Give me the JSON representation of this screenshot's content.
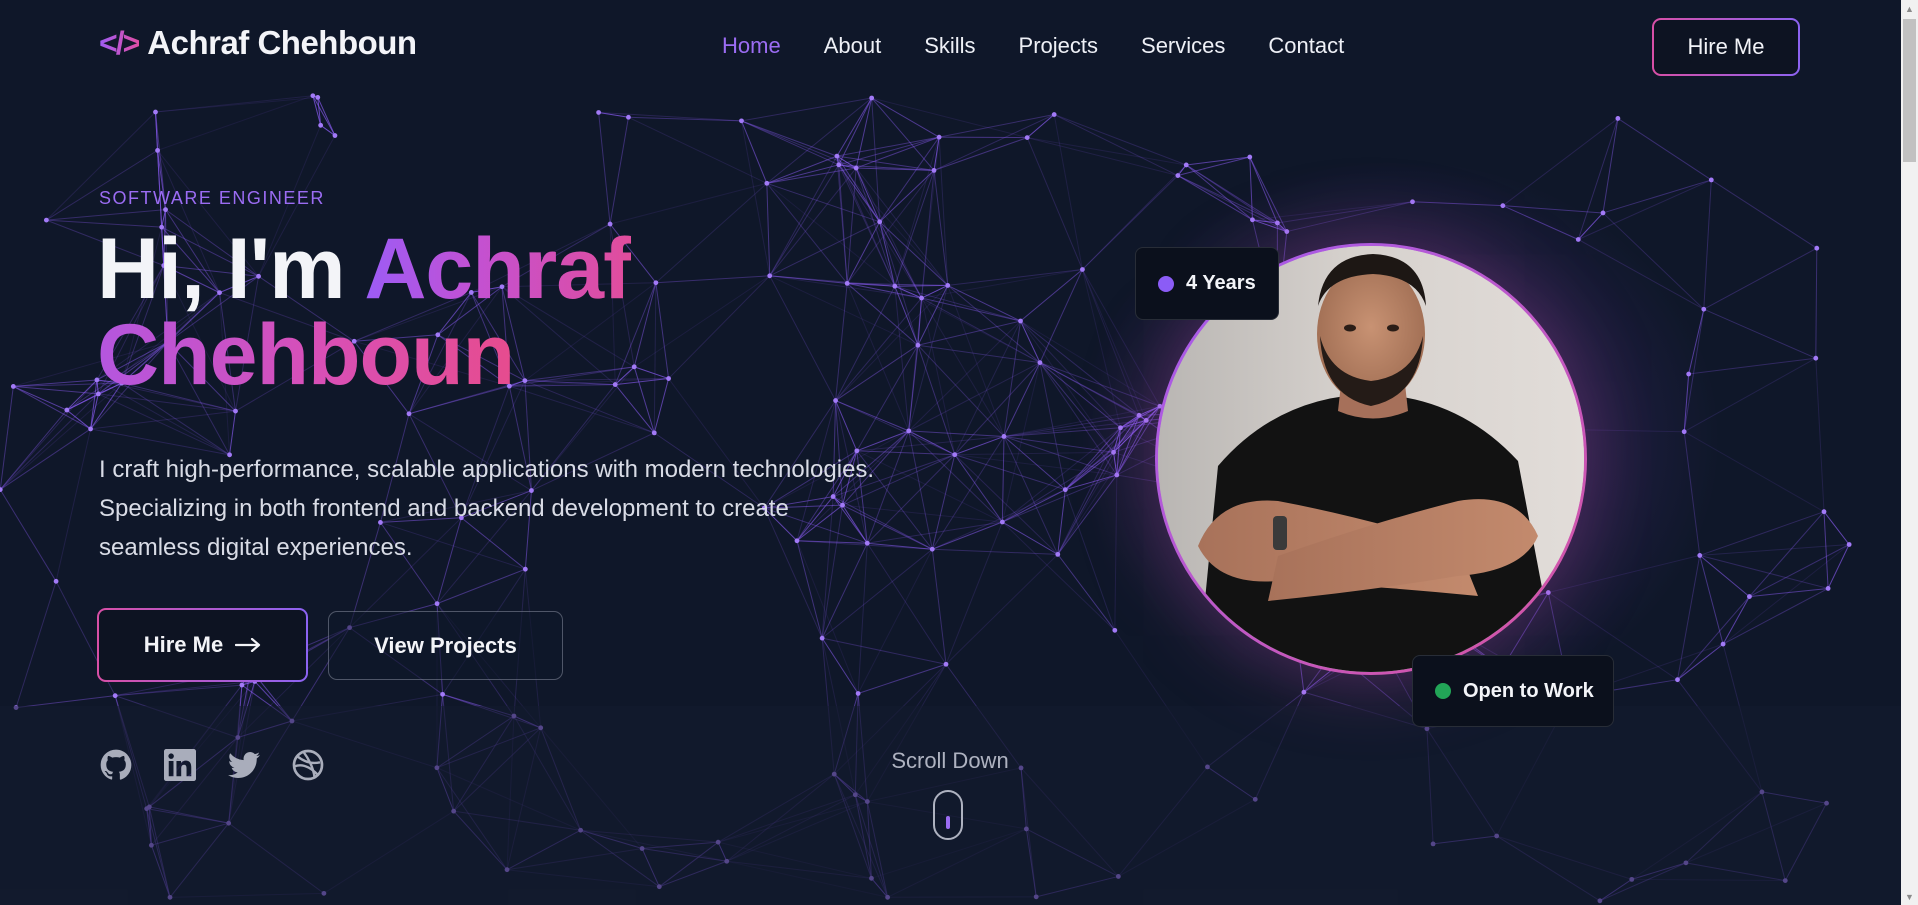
{
  "nav": {
    "logo_icon": "</>",
    "logo_text": "Achraf Chehboun",
    "links": [
      "Home",
      "About",
      "Skills",
      "Projects",
      "Services",
      "Contact"
    ],
    "active_link": "Home",
    "hire_label": "Hire Me"
  },
  "hero": {
    "eyebrow": "SOFTWARE ENGINEER",
    "greeting": "Hi, I'm ",
    "first_name": "Achraf",
    "last_name": "Chehboun",
    "intro": "I craft high-performance, scalable applications with modern technologies. Specializing in both frontend and backend development to create seamless digital experiences.",
    "primary_button": "Hire Me",
    "secondary_button": "View Projects"
  },
  "profile": {
    "years_badge": "4 Years",
    "status_badge": "Open to Work"
  },
  "social": {
    "icons": [
      "github-icon",
      "linkedin-icon",
      "twitter-icon",
      "dribbble-icon"
    ]
  },
  "scroll": {
    "label": "Scroll Down"
  },
  "colors": {
    "background": "#0f1729",
    "accent_purple": "#9b6cf3",
    "accent_pink": "#e14d9c",
    "badge_dot_purple": "#8b5cf6",
    "badge_dot_green": "#22a557",
    "network_line": "#8b5cf6"
  }
}
